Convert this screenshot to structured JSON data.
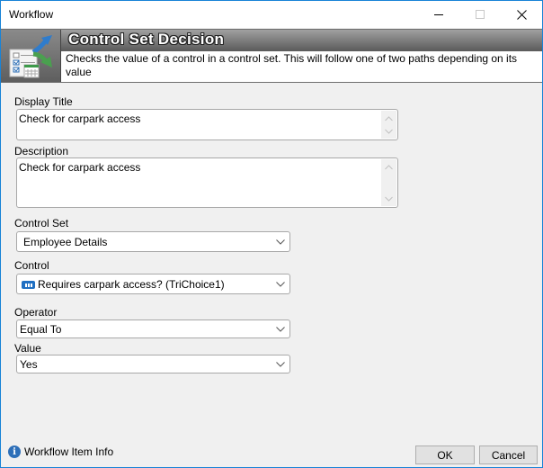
{
  "window": {
    "title": "Workflow",
    "controls": {
      "minimize": "minimize-icon",
      "maximize": "maximize-icon",
      "close": "close-icon"
    }
  },
  "header": {
    "icon": "control-set-decision-icon",
    "title": "Control Set Decision",
    "description": "Checks the value of a control in a control set.  This will follow one of two paths depending on its value"
  },
  "form": {
    "display_title": {
      "label": "Display Title",
      "value": "Check for carpark access"
    },
    "description": {
      "label": "Description",
      "value": "Check for carpark access"
    },
    "control_set": {
      "label": "Control Set",
      "value": "Employee Details"
    },
    "control": {
      "label": "Control",
      "value": "Requires carpark access? (TriChoice1)",
      "icon": "tri-choice-icon"
    },
    "operator": {
      "label": "Operator",
      "value": "Equal To"
    },
    "value": {
      "label": "Value",
      "value": "Yes"
    }
  },
  "footer": {
    "info_link": "Workflow Item Info",
    "ok_label": "OK",
    "cancel_label": "Cancel"
  }
}
